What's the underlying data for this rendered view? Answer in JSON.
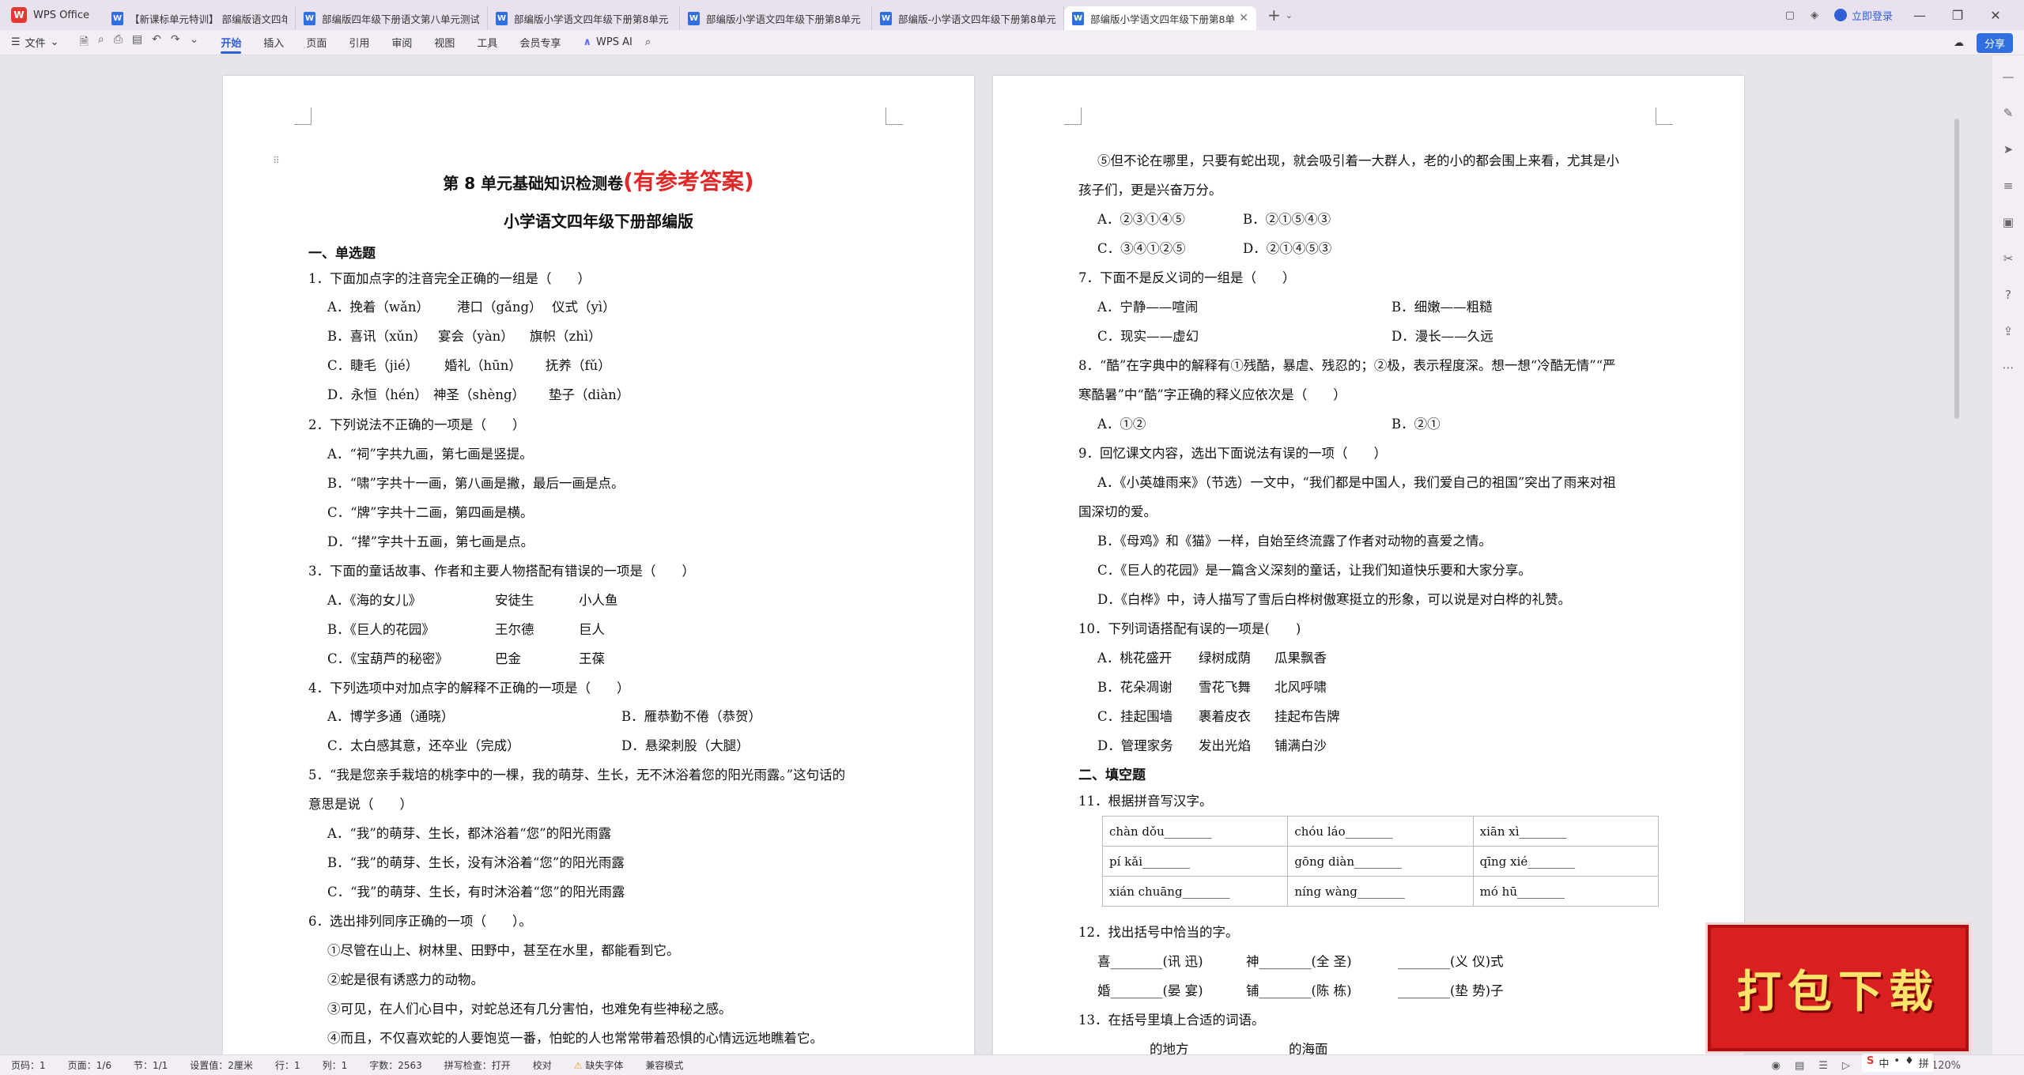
{
  "app": {
    "name": "WPS Office"
  },
  "tabs": [
    {
      "icon": "W",
      "label": "【新课标单元特训】 部编版语文四年",
      "active": false
    },
    {
      "icon": "W",
      "label": "部编版四年级下册语文第八单元测试",
      "active": false
    },
    {
      "icon": "W",
      "label": "部编版小学语文四年级下册第8单元",
      "active": false
    },
    {
      "icon": "W",
      "label": "部编版小学语文四年级下册第8单元",
      "active": false
    },
    {
      "icon": "W",
      "label": "部编版-小学语文四年级下册第8单元",
      "active": false
    },
    {
      "icon": "W",
      "label": "部编版小学语文四年级下册第8单元",
      "active": true
    }
  ],
  "titlebar": {
    "login": "立即登录"
  },
  "toolbar": {
    "file": "文件",
    "tabs": [
      "开始",
      "插入",
      "页面",
      "引用",
      "审阅",
      "视图",
      "工具",
      "会员专享"
    ],
    "active_tab": "开始",
    "ai": "WPS AI",
    "share": "分享"
  },
  "doc": {
    "title_main": "第 8 单元基础知识检测卷",
    "title_red": "(有参考答案)",
    "subtitle": "小学语文四年级下册部编版",
    "sec1": "一、单选题",
    "q1": "1．下面加点字的注音完全正确的一组是（　　）",
    "q1a": [
      "A．挽着（wǎn）",
      "港口（gǎng）",
      "仪式（yì）"
    ],
    "q1b": [
      "B．喜讯（xǔn）",
      "宴会（yàn）",
      "旗帜（zhì）"
    ],
    "q1c": [
      "C．睫毛（jié）",
      "婚礼（hūn）",
      "抚养（fǔ）"
    ],
    "q1d": [
      "D．永恒（hén）",
      "神圣（shèng）",
      "垫子（diàn）"
    ],
    "q2": "2．下列说法不正确的一项是（　　）",
    "q2a": "A．“祠”字共九画，第七画是竖提。",
    "q2b": "B．“啸”字共十一画，第八画是撇，最后一画是点。",
    "q2c": "C．“牌”字共十二画，第四画是横。",
    "q2d": "D．“撵”字共十五画，第七画是点。",
    "q3": "3．下面的童话故事、作者和主要人物搭配有错误的一项是（　　）",
    "q3a": [
      "A．《海的女儿》",
      "安徒生",
      "小人鱼"
    ],
    "q3b": [
      "B．《巨人的花园》",
      "王尔德",
      "巨人"
    ],
    "q3c": [
      "C．《宝葫芦的秘密》",
      "巴金",
      "王葆"
    ],
    "q4": "4．下列选项中对加点字的解释不正确的一项是（　　）",
    "q4a": "A．博学多通（通晓）",
    "q4b": "B．雁恭勤不倦（恭贺）",
    "q4c": "C．太白感其意，还卒业（完成）",
    "q4d": "D．悬梁刺股（大腿）",
    "q5l1": "5．“我是您亲手栽培的桃李中的一棵，我的萌芽、生长，无不沐浴着您的阳光雨露。”这句话的",
    "q5l2": "意思是说（　　）",
    "q5a": "A．“我”的萌芽、生长，都沐浴着“您”的阳光雨露",
    "q5b": "B．“我”的萌芽、生长，没有沐浴着“您”的阳光雨露",
    "q5c": "C．“我”的萌芽、生长，有时沐浴着“您”的阳光雨露",
    "q6": "6．选出排列同序正确的一项（　　）。",
    "q6s1": "①尽管在山上、树林里、田野中，甚至在水里，都能看到它。",
    "q6s2": "②蛇是很有诱惑力的动物。",
    "q6s3": "③可见，在人们心目中，对蛇总还有几分害怕，也难免有些神秘之感。",
    "q6s4": "④而且，不仅喜欢蛇的人要饱览一番，怕蛇的人也常常带着恐惧的心情远远地瞧着它。",
    "r_q6s5l1": "⑤但不论在哪里，只要有蛇出现，就会吸引着一大群人，老的小的都会围上来看，尤其是小",
    "r_q6s5l2": "孩子们，更是兴奋万分。",
    "r_q6a": "A．②③①④⑤",
    "r_q6b": "B．②①⑤④③",
    "r_q6c": "C．③④①②⑤",
    "r_q6d": "D．②①④⑤③",
    "q7": "7．下面不是反义词的一组是（　　）",
    "q7a": "A．宁静——喧闹",
    "q7b": "B．细嫩——粗糙",
    "q7c": "C．现实——虚幻",
    "q7d": "D．漫长——久远",
    "q8l1": "8．“酷”在字典中的解释有①残酷，暴虐、残忍的；②极，表示程度深。想一想“冷酷无情”“严",
    "q8l2": "寒酷暑”中“酷”字正确的释义应依次是（　　）",
    "q8a": "A．①②",
    "q8b": "B．②①",
    "q9": "9．回忆课文内容，选出下面说法有误的一项（　　）",
    "q9a1": "A．《小英雄雨来》（节选）一文中，“我们都是中国人，我们爱自己的祖国”突出了雨来对祖",
    "q9a2": "国深切的爱。",
    "q9b": "B．《母鸡》和《猫》一样，自始至终流露了作者对动物的喜爱之情。",
    "q9c": "C．《巨人的花园》是一篇含义深刻的童话，让我们知道快乐要和大家分享。",
    "q9d": "D．《白桦》中，诗人描写了雪后白桦树傲寒挺立的形象，可以说是对白桦的礼赞。",
    "q10": "10．下列词语搭配有误的一项是(　　)",
    "q10a": [
      "A．桃花盛开",
      "绿树成荫",
      "瓜果飘香"
    ],
    "q10b": [
      "B．花朵凋谢",
      "雪花飞舞",
      "北风呼啸"
    ],
    "q10c": [
      "C．挂起围墙",
      "裹着皮衣",
      "挂起布告牌"
    ],
    "q10d": [
      "D．管理家务",
      "发出光焰",
      "铺满白沙"
    ],
    "sec2": "二、填空题",
    "q11": "11．根据拼音写汉字。",
    "pinyin": [
      [
        "chàn dǒu________",
        "chóu láo________",
        "xiān xì________"
      ],
      [
        "pí kǎi________",
        "gōng diàn________",
        "qīng xié________"
      ],
      [
        "xián chuāng________",
        "níng wàng________",
        "mó hū________"
      ]
    ],
    "q12": "12．找出括号中恰当的字。",
    "q12r1": [
      "喜________(讯  迅)",
      "神________(全  圣)",
      "________(义  仪)式"
    ],
    "q12r2": [
      "婚________(晏  宴)",
      "铺________(陈  栋)",
      "________(垫  势)子"
    ],
    "q13": "13．在括号里填上合适的词语。",
    "q13r1": [
      "________的地方",
      "________的海面"
    ]
  },
  "status": {
    "page": "页码：1",
    "pages": "页面：1/6",
    "section": "节：1/1",
    "setting": "设置值：2厘米",
    "row": "行：1",
    "col": "列：1",
    "words": "字数：2563",
    "spell": "拼写检查：打开",
    "proof": "校对",
    "font_missing": "缺失字体",
    "compat": "兼容模式",
    "zoom": "120%"
  },
  "banner": {
    "text": "打包下载"
  },
  "ime": [
    "中",
    "•",
    "♦",
    "拼"
  ]
}
